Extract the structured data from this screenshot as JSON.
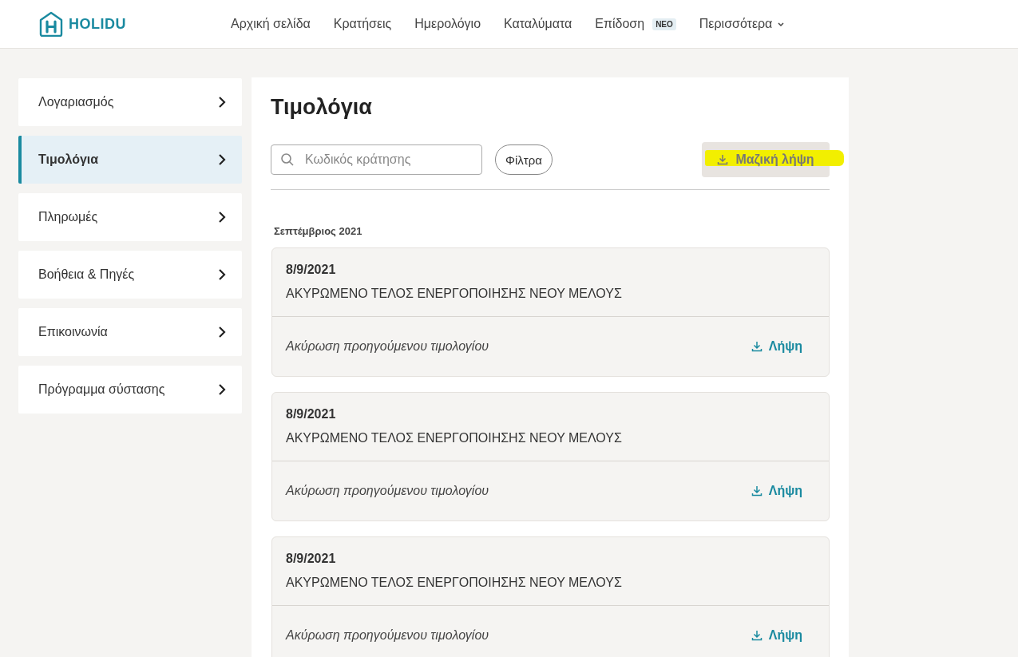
{
  "brand": {
    "name": "HOLIDU"
  },
  "nav": [
    {
      "label": "Αρχική σελίδα"
    },
    {
      "label": "Κρατήσεις"
    },
    {
      "label": "Ημερολόγιο"
    },
    {
      "label": "Καταλύματα"
    },
    {
      "label": "Επίδοση",
      "badge": "ΝΕΟ"
    },
    {
      "label": "Περισσότερα",
      "dropdown": true
    }
  ],
  "sidebar": {
    "items": [
      {
        "label": "Λογαριασμός",
        "selected": false
      },
      {
        "label": "Τιμολόγια",
        "selected": true
      },
      {
        "label": "Πληρωμές",
        "selected": false
      },
      {
        "label": "Βοήθεια & Πηγές",
        "selected": false
      },
      {
        "label": "Επικοινωνία",
        "selected": false
      },
      {
        "label": "Πρόγραμμα σύστασης",
        "selected": false
      }
    ]
  },
  "page": {
    "title": "Τιμολόγια",
    "search": {
      "placeholder": "Κωδικός κράτησης"
    },
    "filter_button": "Φίλτρα",
    "bulk_download": {
      "label": "Μαζική λήψη",
      "highlighted": true
    }
  },
  "groups": [
    {
      "month": "Σεπτέμβριος 2021",
      "invoices": [
        {
          "date": "8/9/2021",
          "title": "ΑΚΥΡΩΜΕΝΟ ΤΕΛΟΣ ΕΝΕΡΓΟΠΟΙΗΣΗΣ ΝΕΟΥ ΜΕΛΟΥΣ",
          "note": "Ακύρωση προηγούμενου τιμολογίου",
          "action": "Λήψη"
        },
        {
          "date": "8/9/2021",
          "title": "ΑΚΥΡΩΜΕΝΟ ΤΕΛΟΣ ΕΝΕΡΓΟΠΟΙΗΣΗΣ ΝΕΟΥ ΜΕΛΟΥΣ",
          "note": "Ακύρωση προηγούμενου τιμολογίου",
          "action": "Λήψη"
        },
        {
          "date": "8/9/2021",
          "title": "ΑΚΥΡΩΜΕΝΟ ΤΕΛΟΣ ΕΝΕΡΓΟΠΟΙΗΣΗΣ ΝΕΟΥ ΜΕΛΟΥΣ",
          "note": "Ακύρωση προηγούμενου τιμολογίου",
          "action": "Λήψη"
        }
      ]
    }
  ]
}
